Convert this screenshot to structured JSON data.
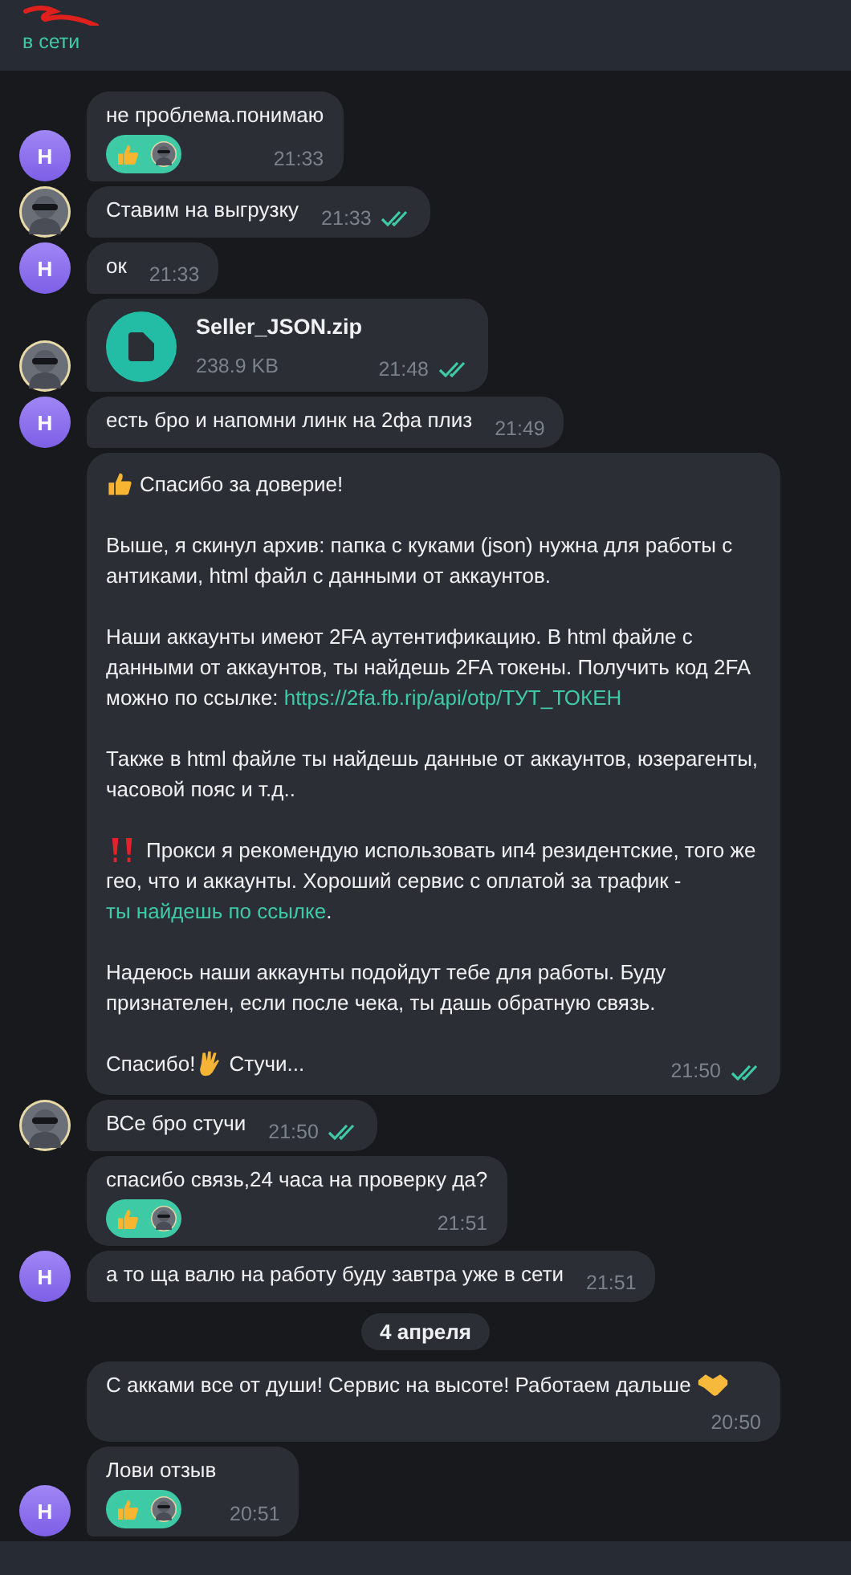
{
  "header": {
    "status": "в сети"
  },
  "messages": [
    {
      "kind": "text",
      "avatar": {
        "kind": "letter",
        "text": "Н"
      },
      "text": "не проблема.понимаю",
      "reactions": [
        {
          "kind": "thumbs-up"
        }
      ],
      "time": "21:33",
      "read": false
    },
    {
      "kind": "text",
      "text": "Ставим на выгрузку",
      "time": "21:33",
      "read": true
    },
    {
      "kind": "text",
      "avatar": {
        "kind": "letter",
        "text": "Н"
      },
      "text": "ок",
      "time": "21:33",
      "read": false
    },
    {
      "kind": "file",
      "file_name": "Seller_JSON.zip",
      "file_size": "238.9 KB",
      "time": "21:48",
      "read": true
    },
    {
      "kind": "text",
      "avatar": {
        "kind": "letter",
        "text": "Н"
      },
      "text": "есть бро и напомни линк на 2фа плиз",
      "time": "21:49",
      "read": false
    },
    {
      "kind": "rich",
      "paragraphs": [
        [
          {
            "kind": "thumbs-up"
          },
          {
            "kind": "text",
            "text": "Спасибо за доверие!"
          }
        ],
        [
          {
            "kind": "text",
            "text": "Выше, я скинул архив: папка с куками (json) нужна для работы с антиками, html файл с данными от аккаунтов."
          }
        ],
        [
          {
            "kind": "text",
            "text": "Наши аккаунты имеют 2FA аутентификацию. В html файле с данными от аккаунтов, ты найдешь 2FA токены. Получить код 2FA можно по ссылке: "
          },
          {
            "kind": "link",
            "text": "https://2fa.fb.rip/api/otp/ТУТ_ТОКЕН"
          }
        ],
        [
          {
            "kind": "text",
            "text": "Также в html файле ты найдешь  данные от аккаунтов, юзерагенты, часовой пояс и т.д.."
          }
        ],
        [
          {
            "kind": "double-exclamation"
          },
          {
            "kind": "text",
            "text": "Прокси я рекомендую использовать ип4 резидентские, того же гео, что и аккаунты. Хороший сервис с оплатой за трафик - "
          },
          {
            "kind": "link",
            "text": "ты найдешь по ссылке"
          },
          {
            "kind": "text",
            "text": "."
          }
        ],
        [
          {
            "kind": "text",
            "text": "Надеюсь наши аккаунты подойдут тебе для работы. Буду признателен, если после чека, ты дашь обратную связь."
          }
        ],
        [
          {
            "kind": "text",
            "text": "Спасибо!"
          },
          {
            "kind": "raised-hand"
          },
          {
            "kind": "text",
            "text": "Стучи..."
          }
        ]
      ],
      "time": "21:50",
      "read": true
    },
    {
      "kind": "text",
      "text": "ВСе бро стучи",
      "time": "21:50",
      "read": true
    },
    {
      "kind": "text",
      "text": "спасибо связь,24 часа на проверку да?",
      "reactions": [
        {
          "kind": "thumbs-up"
        }
      ],
      "time": "21:51",
      "read": false
    },
    {
      "kind": "text",
      "avatar": {
        "kind": "letter",
        "text": "Н"
      },
      "text": "а то ща валю на работу буду завтра уже в сети",
      "time": "21:51",
      "read": false
    },
    {
      "kind": "date",
      "text": "4 апреля"
    },
    {
      "kind": "text",
      "text": "С акками все от души! Сервис на высоте! Работаем дальше",
      "emoji": {
        "kind": "handshake"
      },
      "time": "20:50",
      "read": false
    },
    {
      "kind": "text",
      "avatar": {
        "kind": "letter",
        "text": "Н"
      },
      "text": "Лови отзыв",
      "reactions": [
        {
          "kind": "thumbs-up"
        }
      ],
      "time": "20:51",
      "read": false
    }
  ]
}
